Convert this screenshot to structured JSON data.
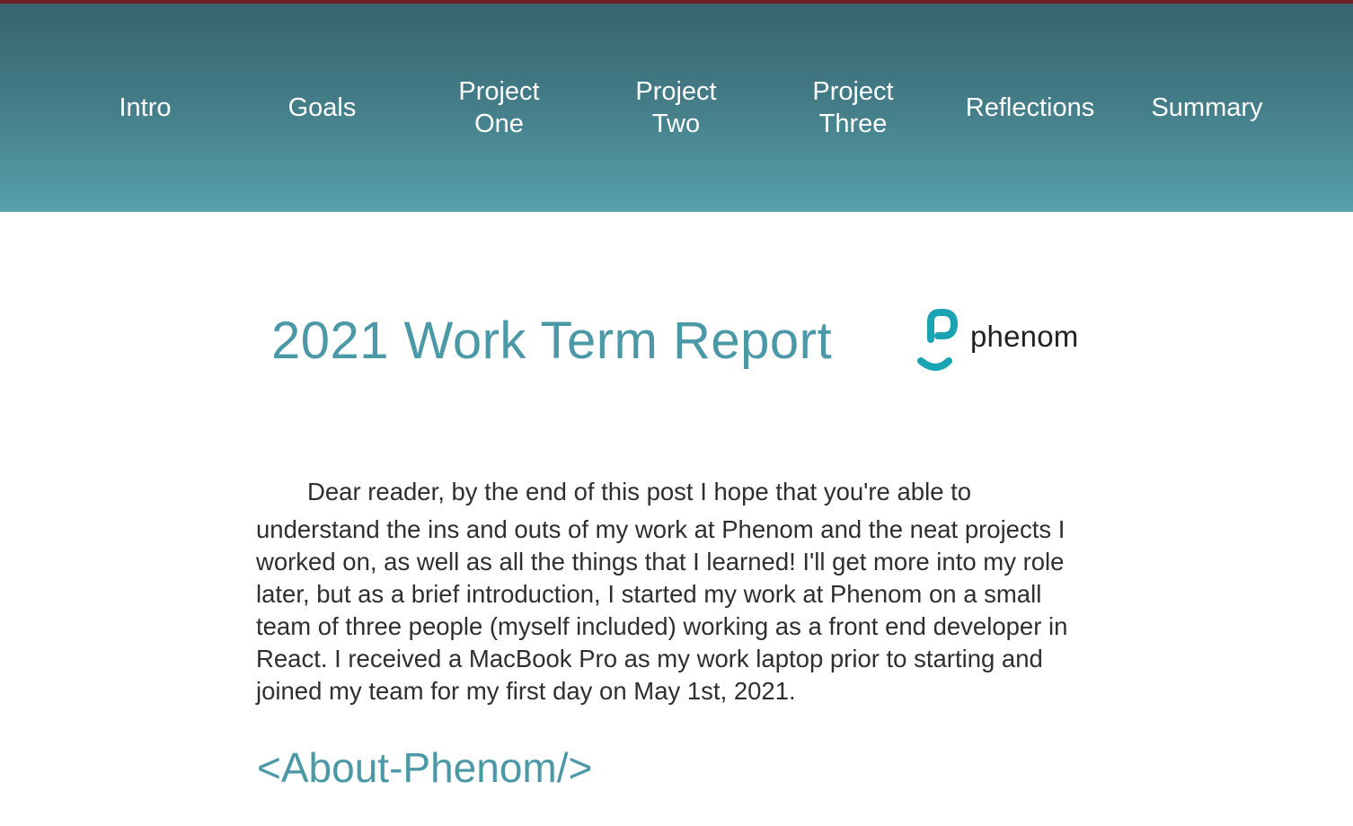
{
  "nav": {
    "items": [
      {
        "lines": [
          "Intro"
        ]
      },
      {
        "lines": [
          "Goals"
        ]
      },
      {
        "lines": [
          "Project",
          "One"
        ]
      },
      {
        "lines": [
          "Project",
          "Two"
        ]
      },
      {
        "lines": [
          "Project",
          "Three"
        ]
      },
      {
        "lines": [
          "Reflections"
        ]
      },
      {
        "lines": [
          "Summary"
        ]
      }
    ]
  },
  "header": {
    "title": "2021 Work Term Report",
    "logo_text": "phenom"
  },
  "intro": {
    "first_line": "Dear reader, by the end of this post I hope that you're able to",
    "rest": "understand the ins and outs of my work at Phenom and the neat projects I worked on, as well as all the things that I learned! I'll get more into my role later, but as a brief introduction, I started my work at Phenom on a small team of three people (myself included) working as a front end developer in React. I received a MacBook Pro as my work laptop prior to starting and joined my team for my first day on May 1st, 2021."
  },
  "section": {
    "heading": "<About-Phenom/>"
  },
  "colors": {
    "accent": "#4b98a6",
    "nav_top": "#37646e",
    "nav_bottom": "#58a1ad",
    "logo_teal": "#1aa3b3",
    "top_border": "#6b1e24"
  }
}
